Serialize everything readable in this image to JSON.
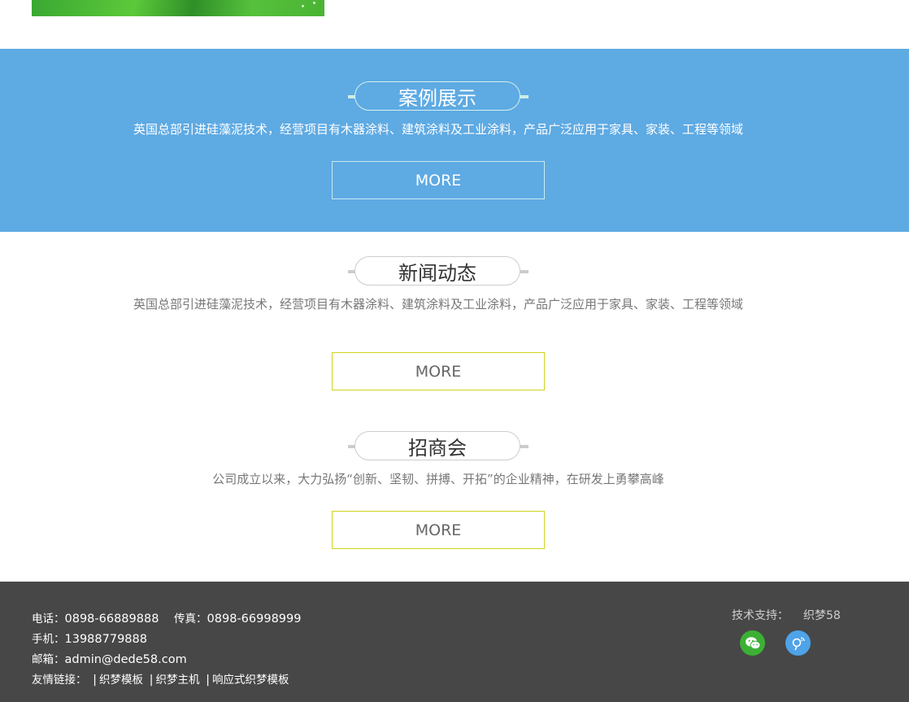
{
  "cases": {
    "title": "案例展示",
    "description": "英国总部引进硅藻泥技术，经营项目有木器涂料、建筑涂料及工业涂料，产品广泛应用于家具、家装、工程等领域",
    "more_label": "MORE"
  },
  "news": {
    "title": "新闻动态",
    "description": "英国总部引进硅藻泥技术，经营项目有木器涂料、建筑涂料及工业涂料，产品广泛应用于家具、家装、工程等领域",
    "more_label": "MORE"
  },
  "invest": {
    "title": "招商会",
    "description": "公司成立以来，大力弘扬“创新、坚韧、拼搏、开拓”的企业精神，在研发上勇攀高峰",
    "more_label": "MORE"
  },
  "footer": {
    "phone_label": "电话：",
    "phone": "0898-66889888",
    "fax_label": "传真：",
    "fax": "0898-66998999",
    "mobile_label": "手机：",
    "mobile": "13988779888",
    "email_label": "邮箱：",
    "email": "admin@dede58.com",
    "links_label": "友情链接：",
    "links": [
      "织梦模板",
      "织梦主机",
      "响应式织梦模板"
    ],
    "support_label": "技术支持：",
    "support_value": "织梦58",
    "social": [
      "wechat-icon",
      "weibo-icon"
    ]
  },
  "colors": {
    "cases_bg": "#5eaae3",
    "footer_bg": "#474747",
    "more_border": "#cfd41e"
  }
}
